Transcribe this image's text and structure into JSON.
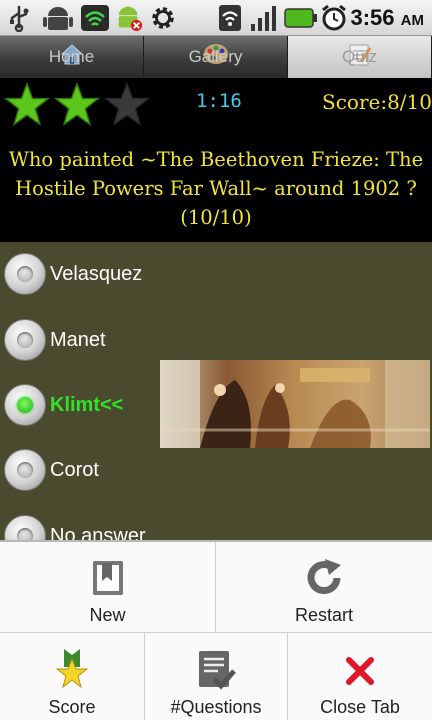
{
  "status_bar": {
    "time": "3:56",
    "ampm": "AM",
    "icons": [
      "usb-icon",
      "android-debug-icon",
      "wifi-sync-icon",
      "android-alert-icon",
      "settings-gear-icon",
      "wifi-icon",
      "signal-icon",
      "battery-icon",
      "alarm-icon"
    ]
  },
  "tabs": [
    {
      "label": "Home",
      "icon": "home-icon",
      "active": false
    },
    {
      "label": "Gallery",
      "icon": "palette-icon",
      "active": false
    },
    {
      "label": "Quiz",
      "icon": "quiz-icon",
      "active": true
    }
  ],
  "quiz": {
    "stars_total": 3,
    "stars_earned": 2,
    "timer": "1:16",
    "score": "Score:8/10",
    "question": "Who painted ~The Beethoven Frieze: The Hostile Powers Far Wall~ around 1902 ? (10/10)",
    "answers": [
      {
        "label": "Velasquez",
        "checked": false
      },
      {
        "label": "Manet",
        "checked": false
      },
      {
        "label": "Klimt<<",
        "checked": true
      },
      {
        "label": "Corot",
        "checked": false
      },
      {
        "label": "No answer",
        "checked": false
      }
    ]
  },
  "menu": {
    "new_label": "New",
    "restart_label": "Restart",
    "score_label": "Score",
    "questions_label": "#Questions",
    "close_label": "Close Tab"
  },
  "colors": {
    "question_text": "#f3e43b",
    "timer_text": "#49c6e0",
    "answers_bg": "#4a4a2e",
    "correct_answer": "#33e02a",
    "star_earned": "#5dc61a",
    "star_empty": "#3a3a3a"
  }
}
